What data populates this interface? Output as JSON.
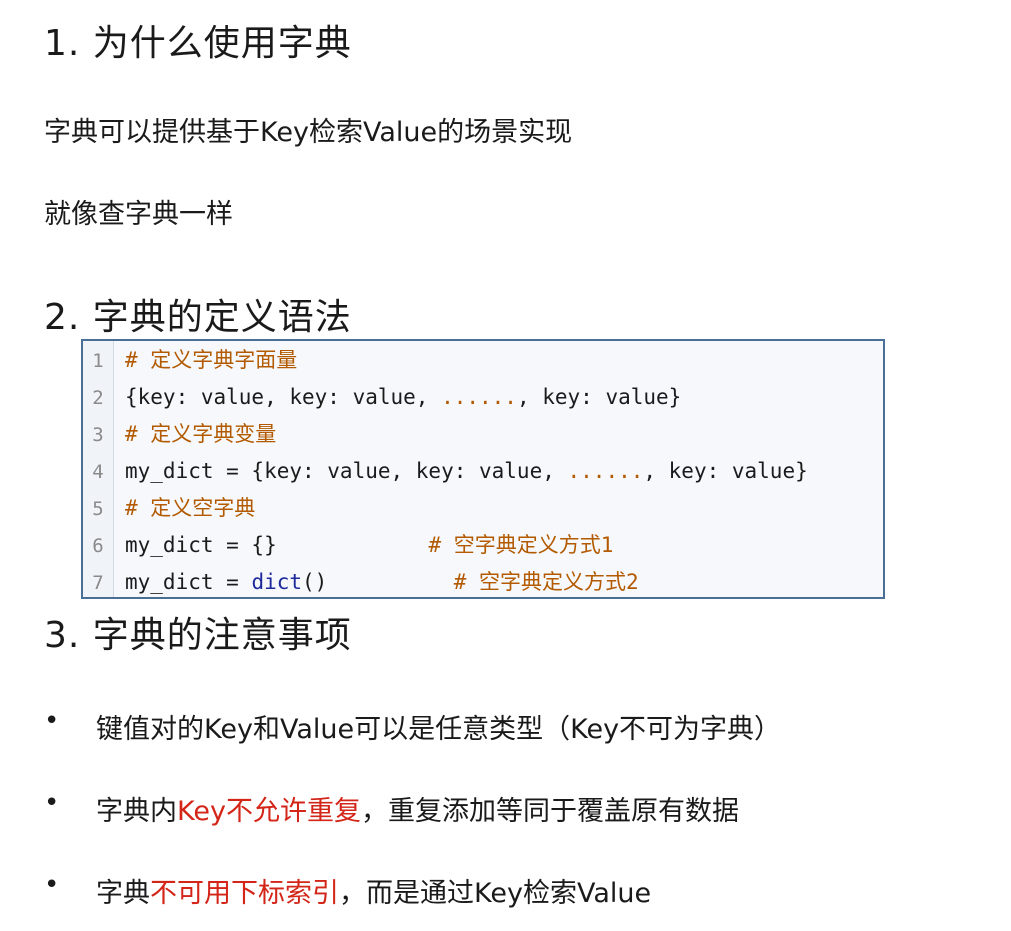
{
  "section1": {
    "heading": "1. 为什么使用字典",
    "lines": [
      "字典可以提供基于Key检索Value的场景实现",
      "就像查字典一样"
    ]
  },
  "section2": {
    "heading": "2. 字典的定义语法",
    "code": [
      {
        "num": "1",
        "parts": [
          {
            "t": "# 定义字典字面量",
            "c": "cmt"
          }
        ]
      },
      {
        "num": "2",
        "parts": [
          {
            "t": "{key: value, key: value, ",
            "c": ""
          },
          {
            "t": "......",
            "c": "dots"
          },
          {
            "t": ", key: value}",
            "c": ""
          }
        ]
      },
      {
        "num": "3",
        "parts": [
          {
            "t": "# 定义字典变量",
            "c": "cmt"
          }
        ]
      },
      {
        "num": "4",
        "parts": [
          {
            "t": "my_dict = {key: value, key: value, ",
            "c": ""
          },
          {
            "t": "......",
            "c": "dots"
          },
          {
            "t": ", key: value}",
            "c": ""
          }
        ]
      },
      {
        "num": "5",
        "parts": [
          {
            "t": "# 定义空字典",
            "c": "cmt"
          }
        ]
      },
      {
        "num": "6",
        "parts": [
          {
            "t": "my_dict = {}            ",
            "c": ""
          },
          {
            "t": "# 空字典定义方式1",
            "c": "cmt"
          }
        ]
      },
      {
        "num": "7",
        "parts": [
          {
            "t": "my_dict = ",
            "c": ""
          },
          {
            "t": "dict",
            "c": "kw"
          },
          {
            "t": "()          ",
            "c": ""
          },
          {
            "t": "# 空字典定义方式2",
            "c": "cmt"
          }
        ]
      }
    ]
  },
  "section3": {
    "heading": "3.  字典的注意事项",
    "bullet_symbol": "•",
    "bullets": [
      {
        "parts": [
          {
            "t": "键值对的Key和Value可以是任意类型（Key不可为字典）",
            "c": ""
          }
        ]
      },
      {
        "parts": [
          {
            "t": "字典内",
            "c": ""
          },
          {
            "t": "Key不允许重复",
            "c": "red"
          },
          {
            "t": "，重复添加等同于覆盖原有数据",
            "c": ""
          }
        ]
      },
      {
        "parts": [
          {
            "t": "字典",
            "c": ""
          },
          {
            "t": "不可用下标索引",
            "c": "red"
          },
          {
            "t": "，而是通过Key检索Value",
            "c": ""
          }
        ]
      }
    ]
  },
  "colors": {
    "comment": "#b35a00",
    "builtin": "#1e2a9c",
    "highlight": "#d32518",
    "code_border": "#4a6f96"
  }
}
